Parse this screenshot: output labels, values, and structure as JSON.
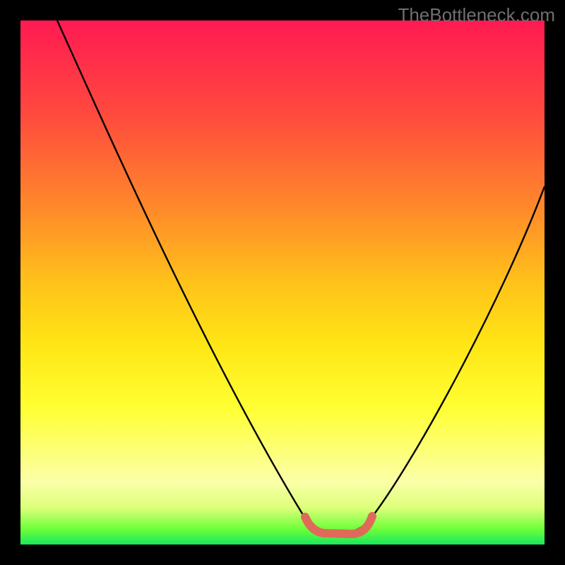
{
  "watermark": "TheBottleneck.com",
  "chart_data": {
    "type": "line",
    "title": "",
    "xlabel": "",
    "ylabel": "",
    "xlim": [
      0,
      100
    ],
    "ylim": [
      0,
      100
    ],
    "series": [
      {
        "name": "bottleneck-curve",
        "color": "#000000",
        "x": [
          7,
          12,
          18,
          24,
          30,
          36,
          42,
          48,
          52,
          56,
          58,
          62,
          66,
          68,
          74,
          80,
          86,
          92,
          98,
          100
        ],
        "y": [
          100,
          90,
          79,
          68,
          57,
          46,
          35,
          23,
          12,
          4,
          2,
          2,
          3,
          7,
          18,
          30,
          42,
          53,
          64,
          68
        ]
      },
      {
        "name": "optimal-range-marker",
        "color": "#e06a5a",
        "x": [
          55,
          57,
          59,
          61,
          63,
          65,
          67
        ],
        "y": [
          3.5,
          2.2,
          1.8,
          1.8,
          1.8,
          2.2,
          3.8
        ]
      }
    ],
    "gradient_stops": [
      {
        "pos": 0,
        "color": "#ff1a52"
      },
      {
        "pos": 18,
        "color": "#ff4a3e"
      },
      {
        "pos": 36,
        "color": "#ff8a2a"
      },
      {
        "pos": 50,
        "color": "#ffc21a"
      },
      {
        "pos": 62,
        "color": "#ffe615"
      },
      {
        "pos": 74,
        "color": "#ffff33"
      },
      {
        "pos": 88,
        "color": "#fbffa8"
      },
      {
        "pos": 93,
        "color": "#dcff7a"
      },
      {
        "pos": 97,
        "color": "#6fff3a"
      },
      {
        "pos": 100,
        "color": "#18e85c"
      }
    ]
  }
}
